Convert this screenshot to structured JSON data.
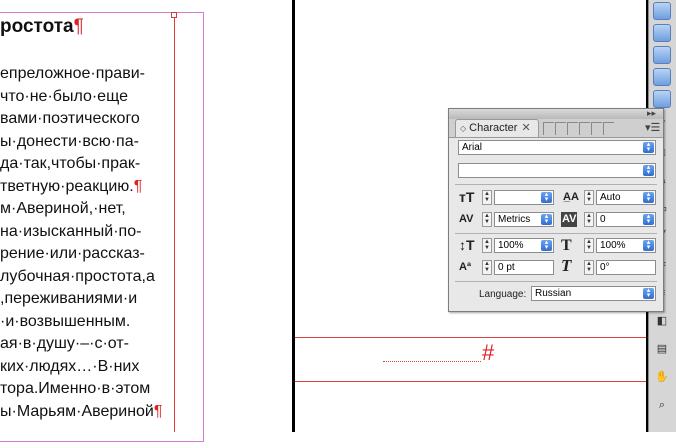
{
  "document": {
    "heading": "ростота",
    "pilcrow": "¶",
    "lines": [
      "епреложное·прави-",
      "что·не·было·еще",
      "вами·поэтического",
      "ы·донести·всю·па-",
      "да·так,чтобы·прак-",
      "тветную·реакцию.",
      "м·Авериной,·нет,",
      "на·изысканный·по-",
      "рение·или·рассказ-",
      "лубочная·простота,а",
      ",переживаниями·и",
      "·и·возвышенным.",
      "ая·в·душу·–·с·от-",
      "ких·людях…·В·них",
      "тора.Именно·в·этом",
      "ы·Марьям·Авериной"
    ],
    "line_pilcrows": [
      "",
      "",
      "",
      "",
      "",
      "¶",
      "",
      "",
      "",
      "",
      "",
      "",
      "",
      "",
      "",
      "¶"
    ],
    "empty_paragraph_mark": "#"
  },
  "character_panel": {
    "tab_label": "Character",
    "font_family": "Arial",
    "font_style": "",
    "font_size": "",
    "leading": "Auto",
    "kerning": "Metrics",
    "tracking": "0",
    "vertical_scale": "100%",
    "horizontal_scale": "100%",
    "baseline_shift": "0 pt",
    "skew": "0°",
    "language_label": "Language:",
    "language": "Russian"
  },
  "icons": {
    "font_size": "font-size-icon",
    "leading": "leading-icon",
    "kerning": "kerning-icon",
    "tracking": "tracking-icon",
    "vertical_scale": "vertical-scale-icon",
    "horizontal_scale": "horizontal-scale-icon",
    "baseline_shift": "baseline-shift-icon",
    "skew": "skew-icon"
  },
  "colors": {
    "guide": "#e04040",
    "frame": "#d67ad6",
    "dropdown_accent": "#2f6ed0"
  }
}
